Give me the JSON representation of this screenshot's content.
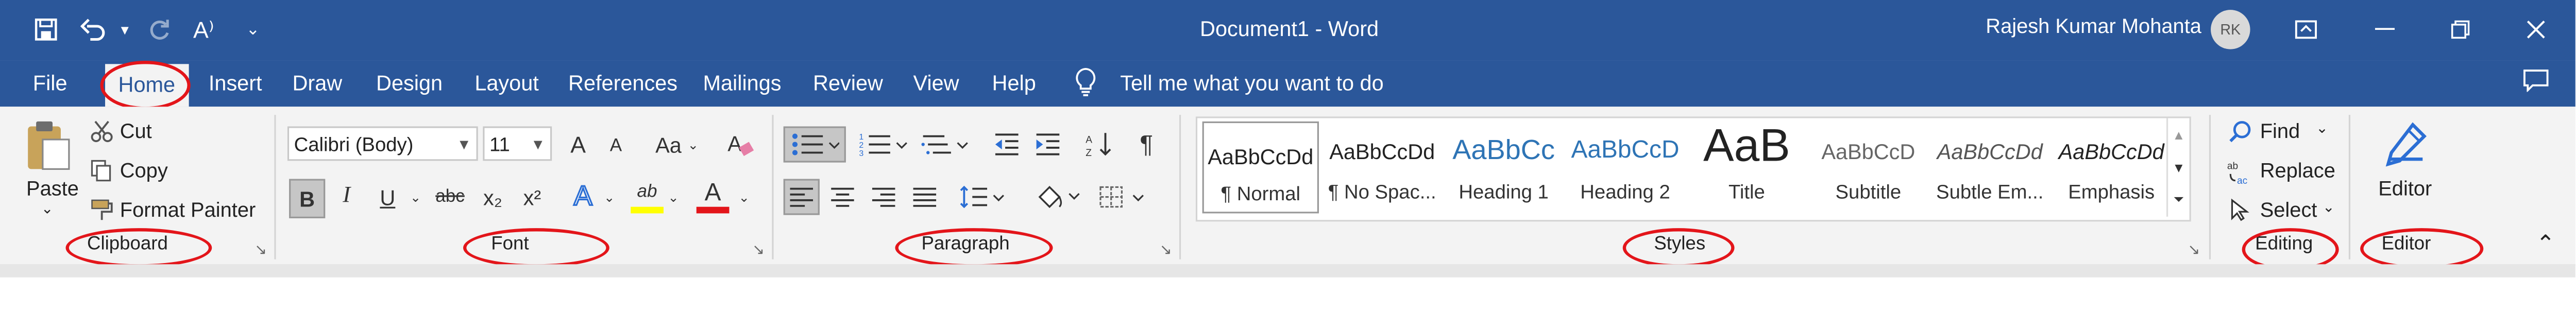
{
  "window": {
    "title": "Document1  -  Word",
    "user_name": "Rajesh Kumar Mohanta",
    "user_initials": "RK",
    "accent": "#2b579a",
    "highlight": "#e3151a"
  },
  "qat": {
    "save_icon": "save-icon",
    "undo_icon": "undo-icon",
    "redo_icon": "redo-icon",
    "readaloud_label": "A⁾"
  },
  "tabs": [
    "File",
    "Home",
    "Insert",
    "Draw",
    "Design",
    "Layout",
    "References",
    "Mailings",
    "Review",
    "View",
    "Help"
  ],
  "tell_me": "Tell me what you want to do",
  "clipboard": {
    "group": "Clipboard",
    "paste": "Paste",
    "cut": "Cut",
    "copy": "Copy",
    "format_painter": "Format Painter"
  },
  "font": {
    "group": "Font",
    "name": "Calibri (Body)",
    "size": "11",
    "grow": "A",
    "shrink": "A",
    "case": "Aa",
    "bold": "B",
    "italic": "I",
    "underline": "U",
    "strike": "abc",
    "subscript": "x₂",
    "superscript": "x²",
    "effects": "A",
    "highlight": "ab",
    "color": "A"
  },
  "paragraph": {
    "group": "Paragraph",
    "pilcrow": "¶"
  },
  "styles": {
    "group": "Styles",
    "items": [
      {
        "preview": "AaBbCcDd",
        "name": "¶ Normal"
      },
      {
        "preview": "AaBbCcDd",
        "name": "¶ No Spac..."
      },
      {
        "preview": "AaBbCc",
        "name": "Heading 1"
      },
      {
        "preview": "AaBbCcD",
        "name": "Heading 2"
      },
      {
        "preview": "AaB",
        "name": "Title"
      },
      {
        "preview": "AaBbCcD",
        "name": "Subtitle"
      },
      {
        "preview": "AaBbCcDd",
        "name": "Subtle Em..."
      },
      {
        "preview": "AaBbCcDd",
        "name": "Emphasis"
      }
    ]
  },
  "editing": {
    "group": "Editing",
    "find": "Find",
    "replace": "Replace",
    "select": "Select"
  },
  "editor": {
    "group": "Editor",
    "label": "Editor"
  }
}
